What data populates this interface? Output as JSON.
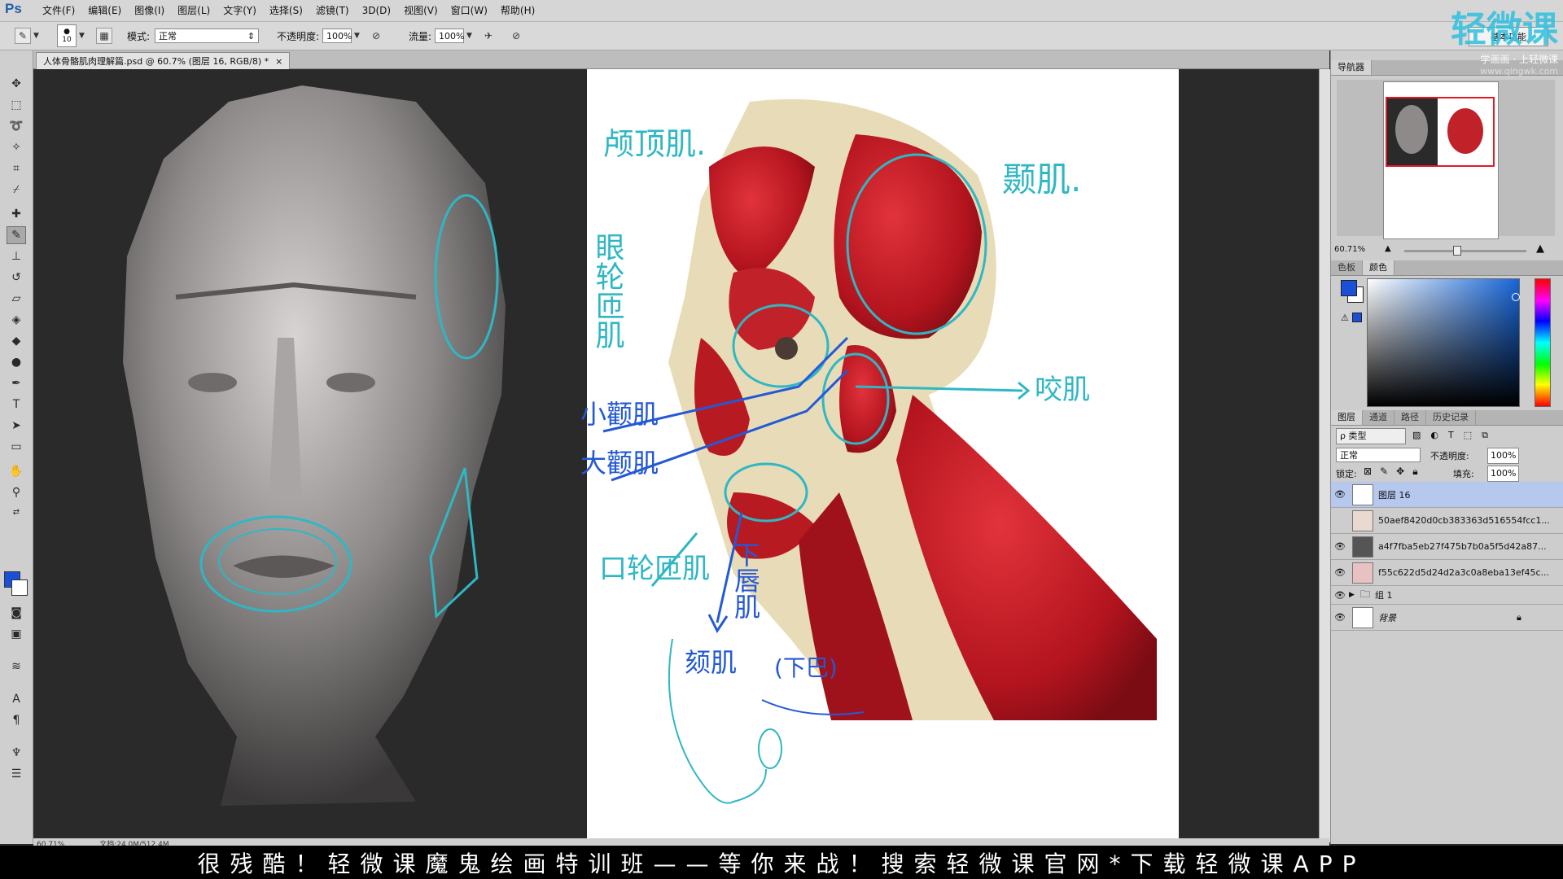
{
  "app": {
    "logo": "Ps"
  },
  "menu": [
    "文件(F)",
    "编辑(E)",
    "图像(I)",
    "图层(L)",
    "文字(Y)",
    "选择(S)",
    "滤镜(T)",
    "3D(D)",
    "视图(V)",
    "窗口(W)",
    "帮助(H)"
  ],
  "options": {
    "brush_size": "10",
    "mode_label": "模式:",
    "mode_value": "正常",
    "opacity_label": "不透明度:",
    "opacity_value": "100%",
    "flow_label": "流量:",
    "flow_value": "100%",
    "workspace": "基本功能"
  },
  "document": {
    "tab_title": "人体骨骼肌肉理解篇.psd @ 60.7% (图层 16, RGB/8) *",
    "close": "×",
    "status_zoom": "60.71%",
    "status_doc": "文档:24.0M/512.4M"
  },
  "annotations": {
    "a1": "颅顶肌.",
    "a2": "颞肌.",
    "a3": "眼轮匝肌",
    "a4": "咬肌",
    "a5": "小颧肌",
    "a6": "大颧肌",
    "a7": "口轮匝肌",
    "a8": "下唇肌",
    "a9": "颏肌",
    "a10": "(下巴)"
  },
  "navigator": {
    "tab": "导航器",
    "zoom": "60.71%"
  },
  "color": {
    "tabs": [
      "色板",
      "颜色"
    ],
    "fg": "#1a4fd8",
    "bg": "#ffffff"
  },
  "layers": {
    "tabs": [
      "图层",
      "通道",
      "路径",
      "历史记录"
    ],
    "filter": "ρ 类型",
    "blend_mode": "正常",
    "opacity_label": "不透明度:",
    "opacity_value": "100%",
    "lock_label": "锁定:",
    "fill_label": "填充:",
    "fill_value": "100%",
    "items": [
      {
        "name": "图层 16",
        "visible": true,
        "selected": true
      },
      {
        "name": "50aef8420d0cb383363d516554fcc1...",
        "visible": false,
        "selected": false
      },
      {
        "name": "a4f7fba5eb27f475b7b0a5f5d42a87...",
        "visible": true,
        "selected": false
      },
      {
        "name": "f55c622d5d24d2a3c0a8eba13ef45c...",
        "visible": true,
        "selected": false
      },
      {
        "name": "组 1",
        "visible": true,
        "selected": false
      },
      {
        "name": "背景",
        "visible": true,
        "selected": false
      }
    ]
  },
  "banner": "很残酷！轻微课魔鬼绘画特训班——等你来战！搜索轻微课官网*下载轻微课APP",
  "watermark": {
    "logo": "轻微课",
    "sub": "学画画 · 上轻微课",
    "url": "www.qingwk.com"
  }
}
